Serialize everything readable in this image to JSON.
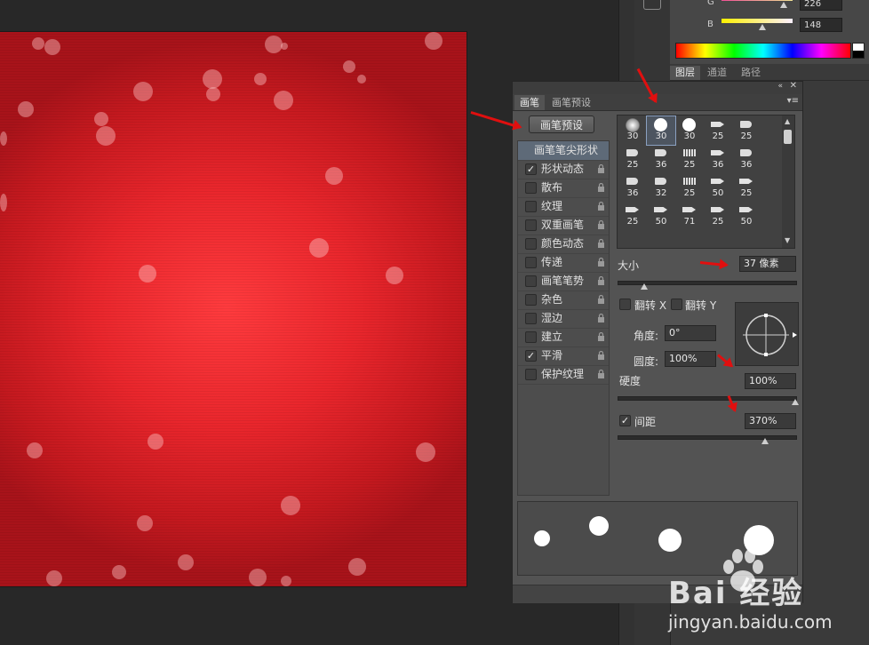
{
  "color_panel": {
    "g_label": "G",
    "g_value": "226",
    "b_label": "B",
    "b_value": "148"
  },
  "layer_tabs": [
    "图层",
    "通道",
    "路径"
  ],
  "brush_panel": {
    "tabs": [
      "画笔",
      "画笔预设"
    ],
    "preset_button": "画笔预设",
    "options": [
      {
        "label": "画笔笔尖形状",
        "checked": null,
        "selected": true
      },
      {
        "label": "形状动态",
        "checked": true
      },
      {
        "label": "散布",
        "checked": false
      },
      {
        "label": "纹理",
        "checked": false
      },
      {
        "label": "双重画笔",
        "checked": false
      },
      {
        "label": "颜色动态",
        "checked": false
      },
      {
        "label": "传递",
        "checked": false
      },
      {
        "label": "画笔笔势",
        "checked": false
      },
      {
        "label": "杂色",
        "checked": false
      },
      {
        "label": "湿边",
        "checked": false
      },
      {
        "label": "建立",
        "checked": false
      },
      {
        "label": "平滑",
        "checked": true
      },
      {
        "label": "保护纹理",
        "checked": false
      }
    ],
    "tips": [
      "30",
      "30",
      "30",
      "25",
      "25",
      "25",
      "36",
      "25",
      "36",
      "36",
      "36",
      "32",
      "25",
      "50",
      "25",
      "25",
      "50",
      "71",
      "25",
      "50"
    ],
    "size_label": "大小",
    "size_value": "37 像素",
    "size_fraction": 0.15,
    "flip_x_label": "翻转 X",
    "flip_y_label": "翻转 Y",
    "angle_label": "角度:",
    "angle_value": "0°",
    "roundness_label": "圆度:",
    "roundness_value": "100%",
    "hardness_label": "硬度",
    "hardness_value": "100%",
    "hardness_fraction": 1.0,
    "spacing_label": "间距",
    "spacing_value": "370%",
    "spacing_checked": true,
    "spacing_fraction": 0.83
  },
  "watermark": {
    "brand": "Bai 经验",
    "url": "jingyan.baidu.com"
  }
}
